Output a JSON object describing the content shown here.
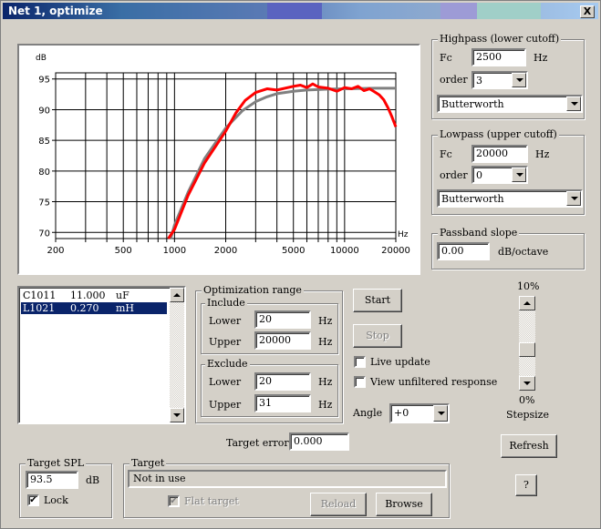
{
  "window": {
    "title": "Net 1, optimize",
    "close_label": "X"
  },
  "chart_data": {
    "type": "line",
    "ylabel": "dB",
    "xunit": "Hz",
    "xscale": "log",
    "xlim": [
      200,
      20000
    ],
    "ylim": [
      69,
      96
    ],
    "xticks": [
      200,
      500,
      1000,
      2000,
      5000,
      10000,
      20000
    ],
    "xtick_labels": [
      "200",
      "500",
      "1000",
      "2000",
      "5000",
      "10000",
      "20000"
    ],
    "yticks": [
      70,
      75,
      80,
      85,
      90,
      95
    ],
    "ytick_labels": [
      "70",
      "75",
      "80",
      "85",
      "90",
      "95"
    ],
    "grid": true,
    "series": [
      {
        "color": "#808080",
        "x": [
          950,
          1000,
          1200,
          1500,
          2000,
          2500,
          3000,
          3500,
          4000,
          5000,
          6000,
          8000,
          10000,
          15000,
          20000
        ],
        "y": [
          69,
          71.2,
          76.5,
          82,
          87,
          89.8,
          91.3,
          92.1,
          92.6,
          93.0,
          93.2,
          93.35,
          93.4,
          93.5,
          93.5
        ]
      },
      {
        "color": "#ff0000",
        "x": [
          920,
          1000,
          1200,
          1500,
          2000,
          2300,
          2600,
          3000,
          3500,
          4000,
          5000,
          5500,
          6000,
          6500,
          7000,
          8000,
          9000,
          10000,
          11000,
          12000,
          13000,
          14000,
          15000,
          16000,
          17000,
          18000,
          19000,
          20000
        ],
        "y": [
          69,
          70.5,
          76,
          81.3,
          86.5,
          89.5,
          91.5,
          92.8,
          93.4,
          93.2,
          93.8,
          94.0,
          93.6,
          94.2,
          93.7,
          93.5,
          93.0,
          93.6,
          93.4,
          93.8,
          93.1,
          93.4,
          92.9,
          92.4,
          91.6,
          90.3,
          88.8,
          87.2
        ]
      }
    ]
  },
  "highpass": {
    "legend": "Highpass (lower cutoff)",
    "fc_label": "Fc",
    "fc_value": "2500",
    "fc_unit": "Hz",
    "order_label": "order",
    "order_value": "3",
    "type_value": "Butterworth"
  },
  "lowpass": {
    "legend": "Lowpass (upper cutoff)",
    "fc_label": "Fc",
    "fc_value": "20000",
    "fc_unit": "Hz",
    "order_label": "order",
    "order_value": "0",
    "type_value": "Butterworth"
  },
  "passband": {
    "legend": "Passband slope",
    "value": "0.00",
    "unit": "dB/octave"
  },
  "components": [
    {
      "name": "C1011",
      "value": "11.000",
      "unit": "uF",
      "selected": false
    },
    {
      "name": "L1021",
      "value": "0.270",
      "unit": "mH",
      "selected": true
    }
  ],
  "optimization": {
    "legend": "Optimization range",
    "include": {
      "legend": "Include",
      "lower_label": "Lower",
      "lower_value": "20",
      "upper_label": "Upper",
      "upper_value": "20000",
      "unit": "Hz"
    },
    "exclude": {
      "legend": "Exclude",
      "lower_label": "Lower",
      "lower_value": "20",
      "upper_label": "Upper",
      "upper_value": "31",
      "unit": "Hz"
    }
  },
  "buttons": {
    "start": "Start",
    "stop": "Stop",
    "refresh": "Refresh",
    "help": "?",
    "reload": "Reload",
    "browse": "Browse"
  },
  "options": {
    "live_update": "Live update",
    "live_update_checked": false,
    "view_unfiltered": "View unfiltered response",
    "view_unfiltered_checked": false
  },
  "angle": {
    "label": "Angle",
    "value": "+0"
  },
  "stepsize": {
    "max_label": "10%",
    "min_label": "0%",
    "label": "Stepsize",
    "position_fraction": 0.62
  },
  "target_error": {
    "label": "Target error",
    "value": "0.000"
  },
  "target_spl": {
    "legend": "Target SPL",
    "value": "93.5",
    "unit": "dB",
    "lock_label": "Lock",
    "lock_checked": true
  },
  "target": {
    "legend": "Target",
    "status": "Not in use",
    "flat_label": "Flat target",
    "flat_checked": true
  }
}
